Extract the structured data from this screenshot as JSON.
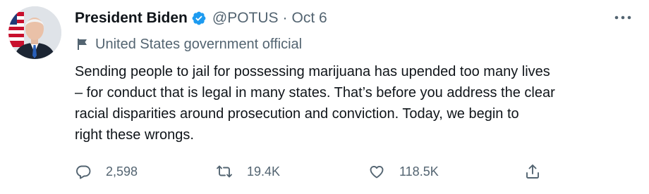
{
  "tweet": {
    "display_name": "President Biden",
    "handle": "@POTUS",
    "separator": "·",
    "date": "Oct 6",
    "account_label": "United States government official",
    "text": "Sending people to jail for possessing marijuana has upended too many lives\n– for conduct that is legal in many states. That’s before you address the clear\nracial disparities around prosecution and conviction. Today, we begin to\nright these wrongs.",
    "stats": {
      "replies": "2,598",
      "retweets": "19.4K",
      "likes": "118.5K"
    }
  },
  "icons": {
    "verified": "verified-badge-icon",
    "more": "more-options-icon",
    "label": "flag-icon",
    "reply": "reply-icon",
    "retweet": "retweet-icon",
    "like": "heart-icon",
    "share": "share-icon"
  },
  "colors": {
    "verified_blue": "#1d9bf0",
    "text_primary": "#0f1419",
    "text_secondary": "#536471"
  }
}
